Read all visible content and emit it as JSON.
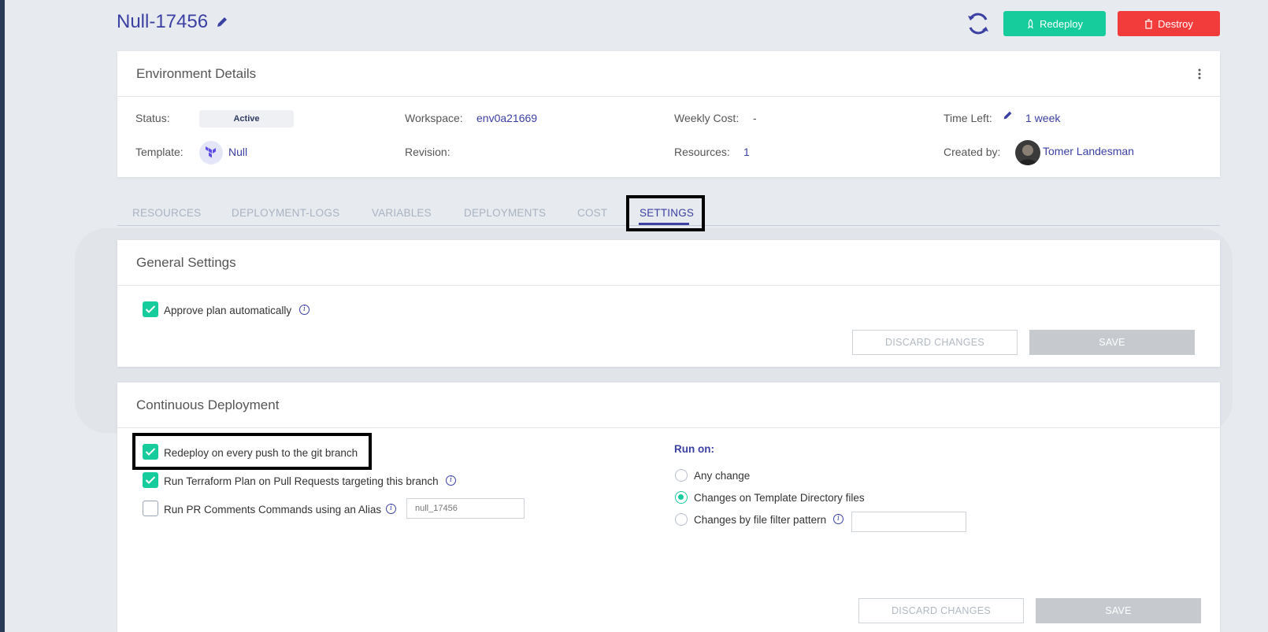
{
  "header": {
    "title": "Null-17456",
    "redeploy_label": "Redeploy",
    "destroy_label": "Destroy"
  },
  "env_details": {
    "heading": "Environment Details",
    "status_label": "Status:",
    "status_value": "Active",
    "workspace_label": "Workspace:",
    "workspace_value": "env0a21669",
    "weekly_cost_label": "Weekly Cost:",
    "weekly_cost_value": "-",
    "time_left_label": "Time Left:",
    "time_left_value": "1 week",
    "template_label": "Template:",
    "template_value": "Null",
    "revision_label": "Revision:",
    "revision_value": "",
    "resources_label": "Resources:",
    "resources_value": "1",
    "created_by_label": "Created by:",
    "created_by_value": "Tomer Landesman"
  },
  "tabs": [
    {
      "label": "RESOURCES"
    },
    {
      "label": "DEPLOYMENT-LOGS"
    },
    {
      "label": "VARIABLES"
    },
    {
      "label": "DEPLOYMENTS"
    },
    {
      "label": "COST"
    },
    {
      "label": "SETTINGS",
      "active": true
    }
  ],
  "general_settings": {
    "heading": "General Settings",
    "approve_label": "Approve plan automatically",
    "approve_checked": true,
    "discard_label": "DISCARD CHANGES",
    "save_label": "SAVE"
  },
  "continuous_deployment": {
    "heading": "Continuous Deployment",
    "redeploy_push_label": "Redeploy on every push to the git branch",
    "redeploy_push_checked": true,
    "terraform_plan_label": "Run Terraform Plan on Pull Requests targeting this branch",
    "terraform_plan_checked": true,
    "pr_comments_label": "Run PR Comments Commands using an Alias",
    "pr_comments_checked": false,
    "alias_placeholder": "null_17456",
    "run_on_label": "Run on:",
    "run_on_options": [
      {
        "label": "Any change",
        "selected": false
      },
      {
        "label": "Changes on Template Directory files",
        "selected": true
      },
      {
        "label": "Changes by file filter pattern",
        "selected": false
      }
    ],
    "filter_value": "",
    "discard_label": "DISCARD CHANGES",
    "save_label": "SAVE"
  },
  "colors": {
    "accent": "#3b40a3",
    "green": "#16cc9c",
    "red": "#f23b3b"
  }
}
